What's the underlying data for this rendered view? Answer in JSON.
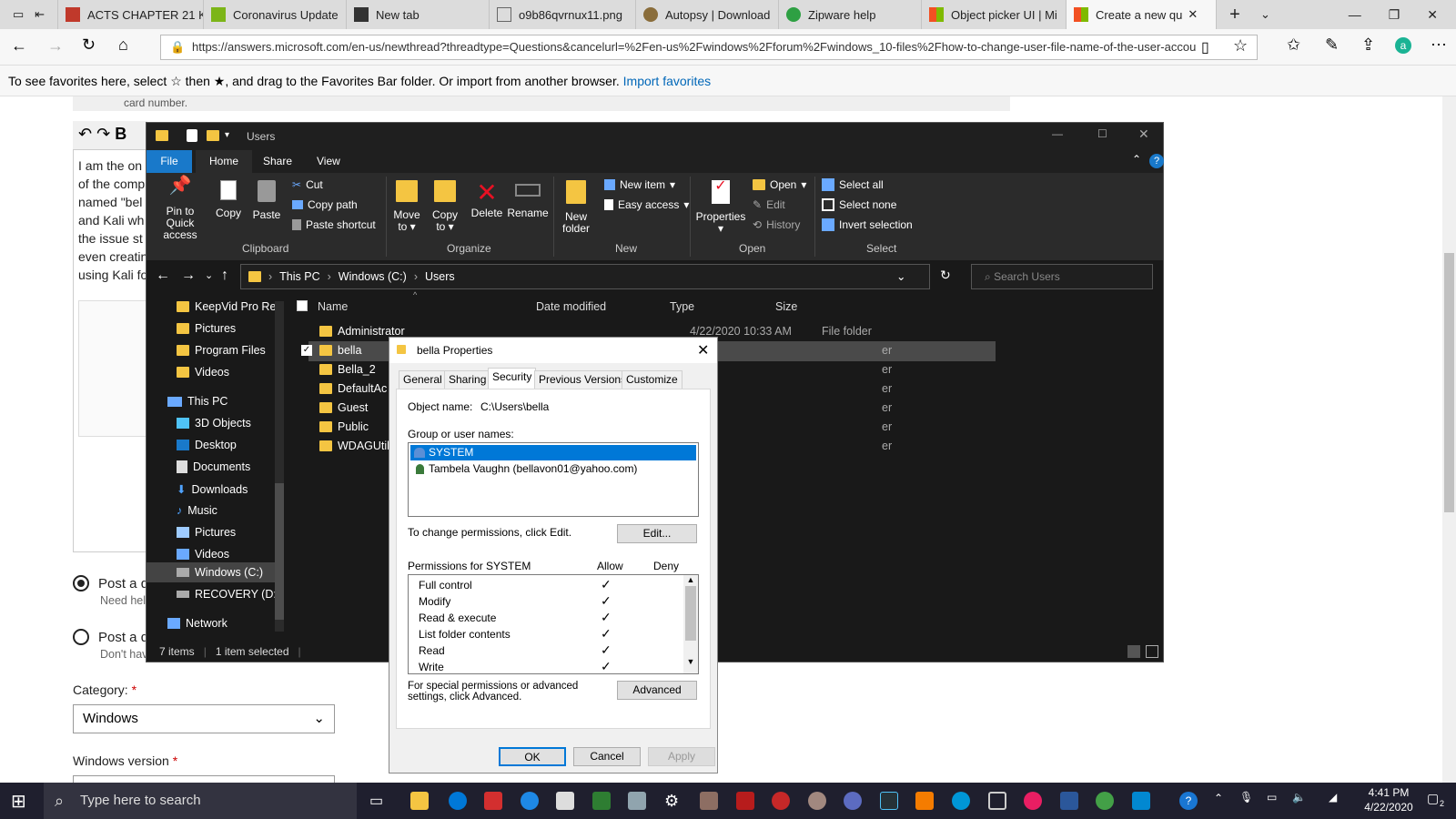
{
  "browser": {
    "tabs": [
      {
        "label": "ACTS CHAPTER 21 K",
        "color": "#c0392b"
      },
      {
        "label": "Coronavirus Update",
        "color": "#7cb518"
      },
      {
        "label": "New tab",
        "color": "#333333"
      },
      {
        "label": "o9b86qvrnux11.png",
        "color": "#888888"
      },
      {
        "label": "Autopsy | Download",
        "color": "#8a6d3b"
      },
      {
        "label": "Zipware help",
        "color": "#2ea043"
      },
      {
        "label": "Object picker UI | Mi",
        "color": "#f25022"
      },
      {
        "label": "Create a new qu",
        "color": "#f25022"
      }
    ],
    "url": "https://answers.microsoft.com/en-us/newthread?threadtype=Questions&cancelurl=%2Fen-us%2Fwindows%2Fforum%2Fwindows_10-files%2Fhow-to-change-user-file-name-of-the-user-accou",
    "favbar_text": "To see favorites here, select ☆ then ★, and drag to the Favorites Bar folder. Or import from another browser.",
    "favbar_link": "Import favorites"
  },
  "page": {
    "partial_top": "card number.",
    "body_lines": [
      "I am the on",
      "of the comp",
      "named \"bel",
      "and Kali wh",
      "the issue st",
      "even creatin",
      "using Kali fo"
    ],
    "radio1_label": "Post a q",
    "radio1_sub": "Need hel",
    "radio2_label": "Post a d",
    "radio2_sub": "Don't hav",
    "category_label": "Category:",
    "category_value": "Windows",
    "version_label": "Windows version",
    "required_mark": "*"
  },
  "explorer": {
    "title": "Users",
    "ribbon_tabs": [
      "File",
      "Home",
      "Share",
      "View"
    ],
    "clipboard": {
      "pin": "Pin to Quick access",
      "copy": "Copy",
      "paste": "Paste",
      "cut": "Cut",
      "copy_path": "Copy path",
      "paste_shortcut": "Paste shortcut",
      "group": "Clipboard"
    },
    "organize": {
      "move_to": "Move to",
      "copy_to": "Copy to",
      "delete": "Delete",
      "rename": "Rename",
      "group": "Organize"
    },
    "new": {
      "new_folder": "New folder",
      "new_item": "New item",
      "easy_access": "Easy access",
      "group": "New"
    },
    "open": {
      "properties": "Properties",
      "open": "Open",
      "edit": "Edit",
      "history": "History",
      "group": "Open"
    },
    "select": {
      "select_all": "Select all",
      "select_none": "Select none",
      "invert": "Invert selection",
      "group": "Select"
    },
    "breadcrumb": [
      "This PC",
      "Windows (C:)",
      "Users"
    ],
    "search_placeholder": "Search Users",
    "columns": [
      "Name",
      "Date modified",
      "Type",
      "Size"
    ],
    "sidebar": [
      "KeepVid Pro Rec",
      "Pictures",
      "Program Files",
      "Videos",
      "This PC",
      "3D Objects",
      "Desktop",
      "Documents",
      "Downloads",
      "Music",
      "Pictures",
      "Videos",
      "Windows (C:)",
      "RECOVERY (D:)",
      "Network"
    ],
    "files": [
      {
        "name": "Administrator",
        "date": "4/22/2020 10:33 AM",
        "type": "File folder"
      },
      {
        "name": "bella",
        "date": "",
        "type": "er"
      },
      {
        "name": "Bella_2",
        "date": "",
        "type": "er"
      },
      {
        "name": "DefaultAc",
        "date": "",
        "type": "er"
      },
      {
        "name": "Guest",
        "date": "",
        "type": "er"
      },
      {
        "name": "Public",
        "date": "",
        "type": "er"
      },
      {
        "name": "WDAGUtil",
        "date": "",
        "type": "er"
      }
    ],
    "status_items": "7 items",
    "status_selected": "1 item selected"
  },
  "dialog": {
    "title": "bella Properties",
    "tabs": [
      "General",
      "Sharing",
      "Security",
      "Previous Versions",
      "Customize"
    ],
    "object_label": "Object name:",
    "object_value": "C:\\Users\\bella",
    "group_label": "Group or user names:",
    "users": [
      "SYSTEM",
      "Tambela Vaughn (bellavon01@yahoo.com)"
    ],
    "change_text": "To change permissions, click Edit.",
    "edit_btn": "Edit...",
    "perm_label": "Permissions for SYSTEM",
    "allow": "Allow",
    "deny": "Deny",
    "permissions": [
      "Full control",
      "Modify",
      "Read & execute",
      "List folder contents",
      "Read",
      "Write"
    ],
    "special_text": "For special permissions or advanced settings, click Advanced.",
    "advanced_btn": "Advanced",
    "ok": "OK",
    "cancel": "Cancel",
    "apply": "Apply"
  },
  "taskbar": {
    "search_placeholder": "Type here to search",
    "time": "4:41 PM",
    "date": "4/22/2020",
    "notif_count": "2"
  }
}
